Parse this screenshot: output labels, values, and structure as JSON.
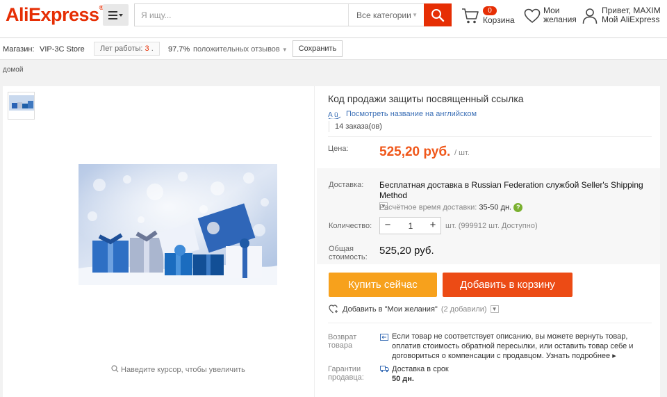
{
  "header": {
    "logo_text": "AliExpress",
    "logo_tm": "®",
    "search": {
      "placeholder": "Я ищу...",
      "category": "Все категории"
    },
    "cart": {
      "count": "0",
      "label": "Корзина"
    },
    "wishlist": {
      "line1": "Мои",
      "line2": "желания"
    },
    "account": {
      "line1": "Привет, MAXIM",
      "line2": "Мой AliExpress"
    }
  },
  "store": {
    "store_label": "Магазин:",
    "name": "VIP-3C Store",
    "years_label": "Лет работы:",
    "years_value": "3",
    "rating_pct": "97.7%",
    "rating_text": "положительных отзывов",
    "save_label": "Сохранить"
  },
  "breadcrumb": "домой",
  "gallery": {
    "zoom_hint": "Наведите курсор, чтобы увеличить"
  },
  "product": {
    "title": "Код продажи защиты посвященный ссылка",
    "translate_link": "Посмотреть название на английском",
    "orders": "14 заказа(ов)",
    "price_label": "Цена:",
    "price": "525,20 руб.",
    "price_unit": "/ шт.",
    "shipping_label": "Доставка:",
    "shipping_text": "Бесплатная доставка в Russian Federation службой Seller's Shipping Method",
    "eta_label": "Расчётное время доставки:",
    "eta_value": "35-50 дн.",
    "qty_label": "Количество:",
    "qty_value": "1",
    "qty_note": "шт. (999912 шт. Доступно)",
    "total_label": "Общая стоимость:",
    "total": "525,20 руб.",
    "buy_now": "Купить сейчас",
    "add_to_cart": "Добавить в корзину",
    "wish_label": "Добавить в \"Мои желания\"",
    "wish_count": "(2 добавили)",
    "return_label": "Возврат товара",
    "return_text": "Если товар не соответствует описанию, вы можете вернуть товар, оплатив стоимость обратной пересылки, или оставить товар себе и договориться о компенсации с продавцом.",
    "return_link": "Узнать подробнее",
    "guarantee_label": "Гарантии продавца:",
    "guarantee_text": "Доставка в срок",
    "guarantee_days": "50 дн."
  },
  "colors": {
    "brand": "#e62e04",
    "buy": "#f7a11c",
    "add": "#ec4b15",
    "price": "#f0571a"
  }
}
